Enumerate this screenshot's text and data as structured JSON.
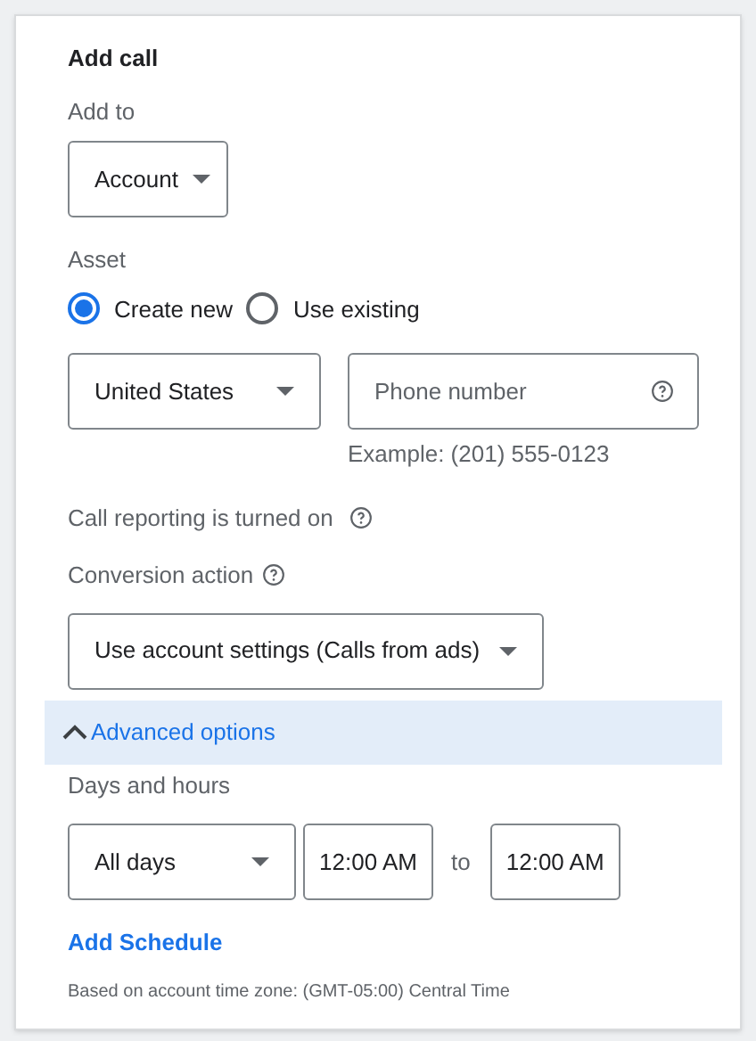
{
  "title": "Add call",
  "add_to": {
    "label": "Add to",
    "value": "Account"
  },
  "asset": {
    "label": "Asset",
    "options": [
      {
        "label": "Create new",
        "selected": true
      },
      {
        "label": "Use existing",
        "selected": false
      }
    ]
  },
  "country": {
    "value": "United States"
  },
  "phone": {
    "placeholder": "Phone number",
    "hint": "Example: (201) 555-0123"
  },
  "call_reporting": {
    "text": "Call reporting is turned on"
  },
  "conversion_action": {
    "label": "Conversion action",
    "value": "Use account settings (Calls from ads)"
  },
  "advanced": {
    "label": "Advanced options",
    "expanded": true
  },
  "schedule": {
    "label": "Days and hours",
    "days": "All days",
    "from": "12:00 AM",
    "separator": "to",
    "until": "12:00 AM",
    "add_link": "Add Schedule",
    "note": "Based on account time zone: (GMT-05:00) Central Time"
  }
}
